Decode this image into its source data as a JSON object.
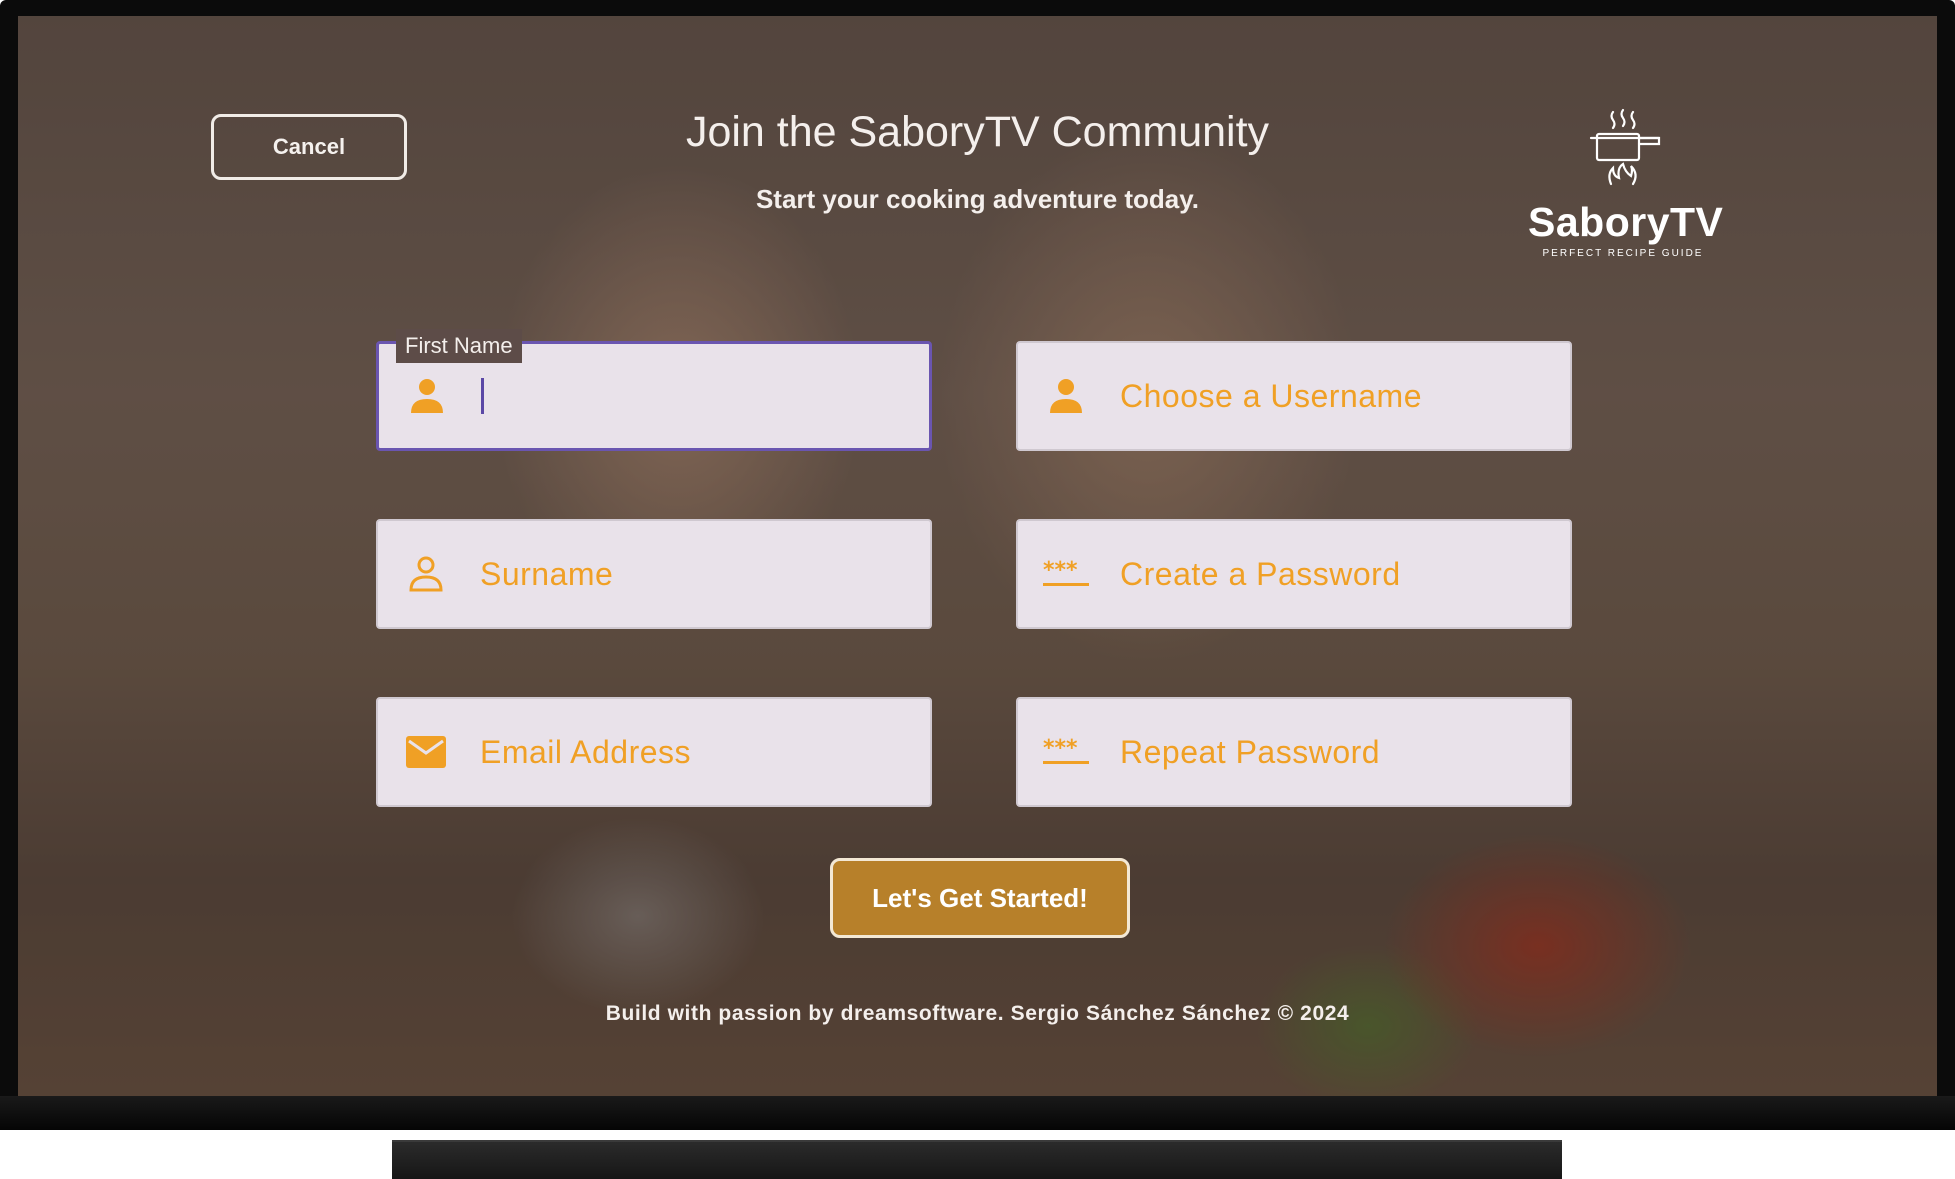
{
  "header": {
    "cancel_label": "Cancel",
    "title": "Join the SaboryTV Community",
    "subtitle": "Start your cooking adventure today."
  },
  "brand": {
    "name": "SaboryTV",
    "tagline": "PERFECT RECIPE GUIDE"
  },
  "form": {
    "first_name": {
      "label": "First Name",
      "value": "",
      "icon": "person-icon"
    },
    "username": {
      "placeholder": "Choose a Username",
      "icon": "person-icon"
    },
    "surname": {
      "placeholder": "Surname",
      "icon": "person-outline-icon"
    },
    "password": {
      "placeholder": "Create a Password",
      "icon": "password-icon"
    },
    "email": {
      "placeholder": "Email Address",
      "icon": "mail-icon"
    },
    "repeat_password": {
      "placeholder": "Repeat Password",
      "icon": "password-icon"
    },
    "submit_label": "Let's Get Started!"
  },
  "footer": {
    "credit": "Build with passion by dreamsoftware. Sergio Sánchez Sánchez © 2024"
  },
  "colors": {
    "accent": "#f0a025",
    "focus": "#6a55b0",
    "field_bg": "#e9e2ea",
    "button_bg": "#b7802a"
  }
}
